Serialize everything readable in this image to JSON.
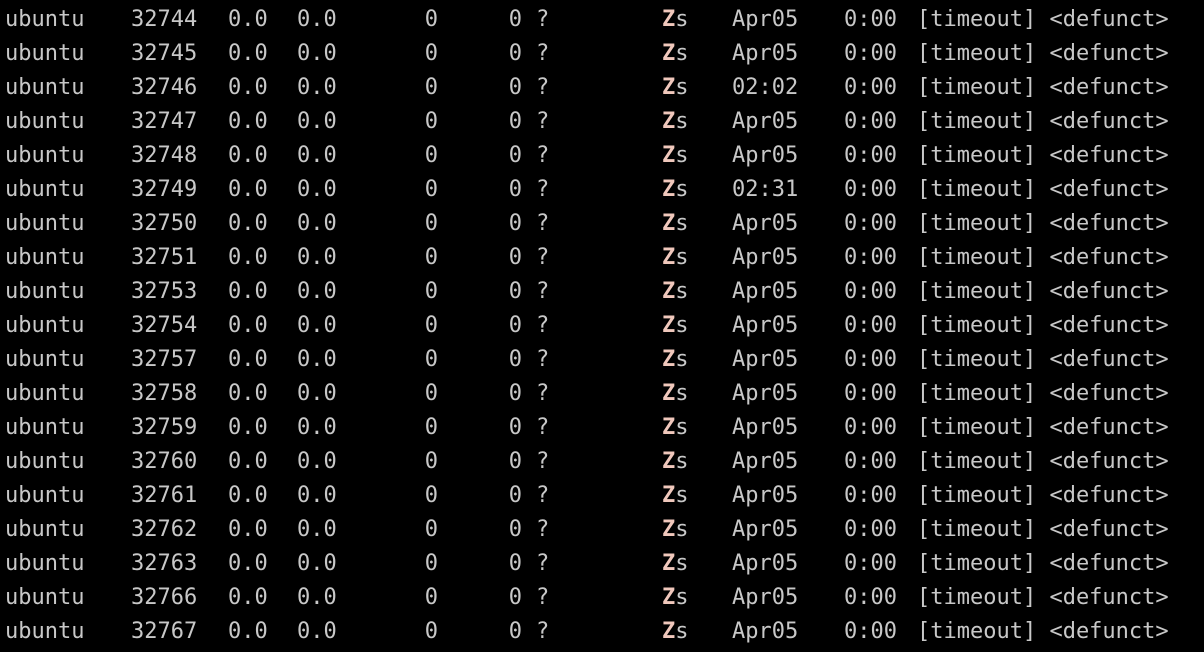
{
  "colors": {
    "background": "#000000",
    "text": "#c8c8c8",
    "zombie_state": "#f0c8bc"
  },
  "processes": [
    {
      "user": "ubuntu",
      "pid": "32744",
      "cpu": "0.0",
      "mem": "0.0",
      "vsz": "0",
      "rss": "0",
      "tty": "?",
      "stat_state": "Z",
      "stat_flags": "s",
      "start": "Apr05",
      "time": "0:00",
      "command": "[timeout] <defunct>"
    },
    {
      "user": "ubuntu",
      "pid": "32745",
      "cpu": "0.0",
      "mem": "0.0",
      "vsz": "0",
      "rss": "0",
      "tty": "?",
      "stat_state": "Z",
      "stat_flags": "s",
      "start": "Apr05",
      "time": "0:00",
      "command": "[timeout] <defunct>"
    },
    {
      "user": "ubuntu",
      "pid": "32746",
      "cpu": "0.0",
      "mem": "0.0",
      "vsz": "0",
      "rss": "0",
      "tty": "?",
      "stat_state": "Z",
      "stat_flags": "s",
      "start": "02:02",
      "time": "0:00",
      "command": "[timeout] <defunct>"
    },
    {
      "user": "ubuntu",
      "pid": "32747",
      "cpu": "0.0",
      "mem": "0.0",
      "vsz": "0",
      "rss": "0",
      "tty": "?",
      "stat_state": "Z",
      "stat_flags": "s",
      "start": "Apr05",
      "time": "0:00",
      "command": "[timeout] <defunct>"
    },
    {
      "user": "ubuntu",
      "pid": "32748",
      "cpu": "0.0",
      "mem": "0.0",
      "vsz": "0",
      "rss": "0",
      "tty": "?",
      "stat_state": "Z",
      "stat_flags": "s",
      "start": "Apr05",
      "time": "0:00",
      "command": "[timeout] <defunct>"
    },
    {
      "user": "ubuntu",
      "pid": "32749",
      "cpu": "0.0",
      "mem": "0.0",
      "vsz": "0",
      "rss": "0",
      "tty": "?",
      "stat_state": "Z",
      "stat_flags": "s",
      "start": "02:31",
      "time": "0:00",
      "command": "[timeout] <defunct>"
    },
    {
      "user": "ubuntu",
      "pid": "32750",
      "cpu": "0.0",
      "mem": "0.0",
      "vsz": "0",
      "rss": "0",
      "tty": "?",
      "stat_state": "Z",
      "stat_flags": "s",
      "start": "Apr05",
      "time": "0:00",
      "command": "[timeout] <defunct>"
    },
    {
      "user": "ubuntu",
      "pid": "32751",
      "cpu": "0.0",
      "mem": "0.0",
      "vsz": "0",
      "rss": "0",
      "tty": "?",
      "stat_state": "Z",
      "stat_flags": "s",
      "start": "Apr05",
      "time": "0:00",
      "command": "[timeout] <defunct>"
    },
    {
      "user": "ubuntu",
      "pid": "32753",
      "cpu": "0.0",
      "mem": "0.0",
      "vsz": "0",
      "rss": "0",
      "tty": "?",
      "stat_state": "Z",
      "stat_flags": "s",
      "start": "Apr05",
      "time": "0:00",
      "command": "[timeout] <defunct>"
    },
    {
      "user": "ubuntu",
      "pid": "32754",
      "cpu": "0.0",
      "mem": "0.0",
      "vsz": "0",
      "rss": "0",
      "tty": "?",
      "stat_state": "Z",
      "stat_flags": "s",
      "start": "Apr05",
      "time": "0:00",
      "command": "[timeout] <defunct>"
    },
    {
      "user": "ubuntu",
      "pid": "32757",
      "cpu": "0.0",
      "mem": "0.0",
      "vsz": "0",
      "rss": "0",
      "tty": "?",
      "stat_state": "Z",
      "stat_flags": "s",
      "start": "Apr05",
      "time": "0:00",
      "command": "[timeout] <defunct>"
    },
    {
      "user": "ubuntu",
      "pid": "32758",
      "cpu": "0.0",
      "mem": "0.0",
      "vsz": "0",
      "rss": "0",
      "tty": "?",
      "stat_state": "Z",
      "stat_flags": "s",
      "start": "Apr05",
      "time": "0:00",
      "command": "[timeout] <defunct>"
    },
    {
      "user": "ubuntu",
      "pid": "32759",
      "cpu": "0.0",
      "mem": "0.0",
      "vsz": "0",
      "rss": "0",
      "tty": "?",
      "stat_state": "Z",
      "stat_flags": "s",
      "start": "Apr05",
      "time": "0:00",
      "command": "[timeout] <defunct>"
    },
    {
      "user": "ubuntu",
      "pid": "32760",
      "cpu": "0.0",
      "mem": "0.0",
      "vsz": "0",
      "rss": "0",
      "tty": "?",
      "stat_state": "Z",
      "stat_flags": "s",
      "start": "Apr05",
      "time": "0:00",
      "command": "[timeout] <defunct>"
    },
    {
      "user": "ubuntu",
      "pid": "32761",
      "cpu": "0.0",
      "mem": "0.0",
      "vsz": "0",
      "rss": "0",
      "tty": "?",
      "stat_state": "Z",
      "stat_flags": "s",
      "start": "Apr05",
      "time": "0:00",
      "command": "[timeout] <defunct>"
    },
    {
      "user": "ubuntu",
      "pid": "32762",
      "cpu": "0.0",
      "mem": "0.0",
      "vsz": "0",
      "rss": "0",
      "tty": "?",
      "stat_state": "Z",
      "stat_flags": "s",
      "start": "Apr05",
      "time": "0:00",
      "command": "[timeout] <defunct>"
    },
    {
      "user": "ubuntu",
      "pid": "32763",
      "cpu": "0.0",
      "mem": "0.0",
      "vsz": "0",
      "rss": "0",
      "tty": "?",
      "stat_state": "Z",
      "stat_flags": "s",
      "start": "Apr05",
      "time": "0:00",
      "command": "[timeout] <defunct>"
    },
    {
      "user": "ubuntu",
      "pid": "32766",
      "cpu": "0.0",
      "mem": "0.0",
      "vsz": "0",
      "rss": "0",
      "tty": "?",
      "stat_state": "Z",
      "stat_flags": "s",
      "start": "Apr05",
      "time": "0:00",
      "command": "[timeout] <defunct>"
    },
    {
      "user": "ubuntu",
      "pid": "32767",
      "cpu": "0.0",
      "mem": "0.0",
      "vsz": "0",
      "rss": "0",
      "tty": "?",
      "stat_state": "Z",
      "stat_flags": "s",
      "start": "Apr05",
      "time": "0:00",
      "command": "[timeout] <defunct>"
    }
  ]
}
